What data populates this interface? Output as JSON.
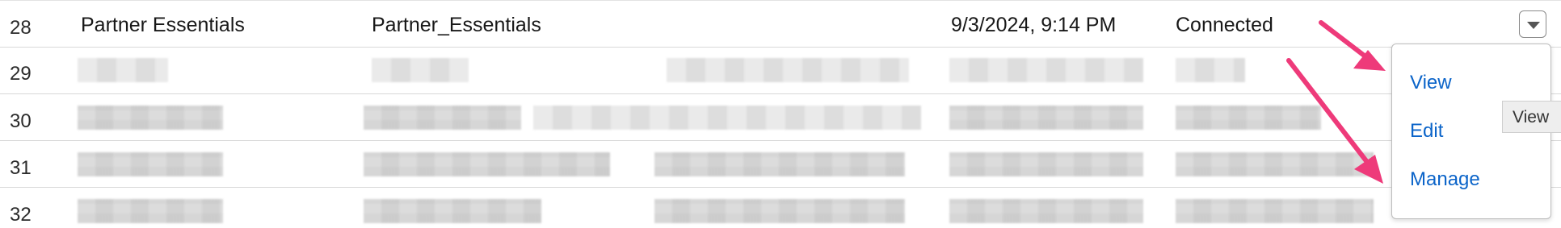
{
  "table": {
    "rows": [
      {
        "number": "28",
        "name": "Partner Essentials",
        "api_name": "Partner_Essentials",
        "date": "9/3/2024, 9:14 PM",
        "status": "Connected"
      },
      {
        "number": "29"
      },
      {
        "number": "30"
      },
      {
        "number": "31"
      },
      {
        "number": "32"
      }
    ]
  },
  "row_menu": {
    "items": [
      {
        "label": "View"
      },
      {
        "label": "Edit"
      },
      {
        "label": "Manage"
      }
    ],
    "tooltip": "View"
  },
  "colors": {
    "link": "#0b64c9",
    "annotation_arrow": "#ee3a7a"
  }
}
